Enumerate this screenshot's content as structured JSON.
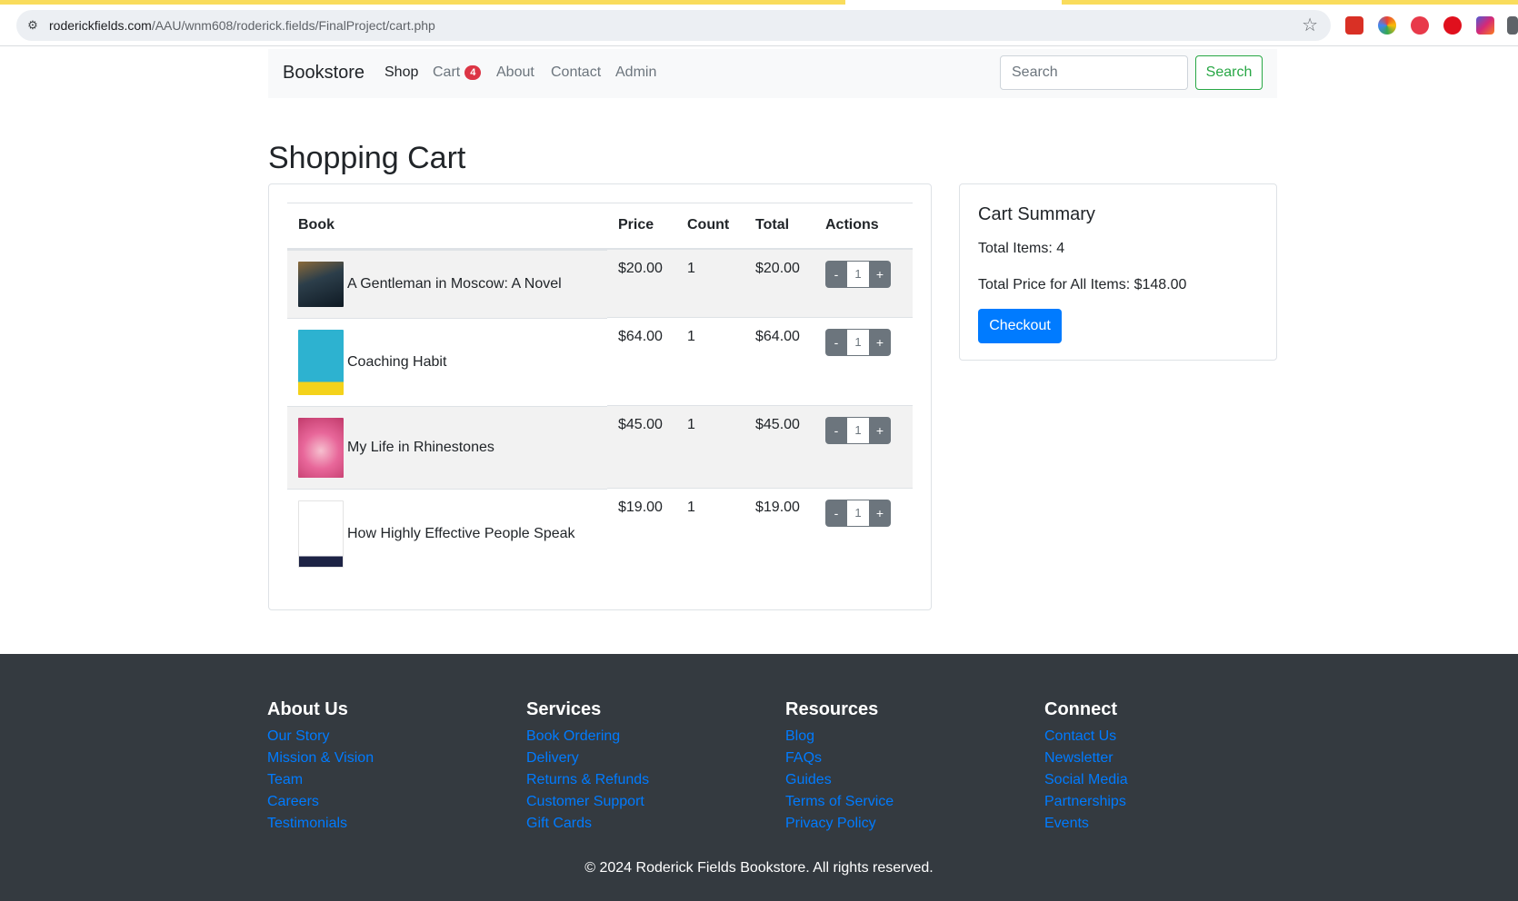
{
  "browser": {
    "url_domain": "roderickfields.com",
    "url_path": "/AAU/wnm608/roderick.fields/FinalProject/cart.php"
  },
  "navbar": {
    "brand": "Bookstore",
    "links": [
      {
        "label": "Shop"
      },
      {
        "label": "Cart",
        "badge": "4"
      },
      {
        "label": "About"
      },
      {
        "label": "Contact"
      },
      {
        "label": "Admin"
      }
    ],
    "search_placeholder": "Search",
    "search_button": "Search"
  },
  "page_title": "Shopping Cart",
  "cart": {
    "headers": [
      "Book",
      "Price",
      "Count",
      "Total",
      "Actions"
    ],
    "rows": [
      {
        "title": "A Gentleman in Moscow: A Novel",
        "price": "$20.00",
        "count": "1",
        "total": "$20.00",
        "qty": "1"
      },
      {
        "title": "Coaching Habit",
        "price": "$64.00",
        "count": "1",
        "total": "$64.00",
        "qty": "1"
      },
      {
        "title": "My Life in Rhinestones",
        "price": "$45.00",
        "count": "1",
        "total": "$45.00",
        "qty": "1"
      },
      {
        "title": "How Highly Effective People Speak",
        "price": "$19.00",
        "count": "1",
        "total": "$19.00",
        "qty": "1"
      }
    ],
    "minus_label": "-",
    "plus_label": "+"
  },
  "summary": {
    "title": "Cart Summary",
    "total_items": "Total Items: 4",
    "total_price": "Total Price for All Items: $148.00",
    "checkout_label": "Checkout"
  },
  "footer": {
    "columns": [
      {
        "heading": "About Us",
        "links": [
          "Our Story",
          "Mission & Vision",
          "Team",
          "Careers",
          "Testimonials"
        ]
      },
      {
        "heading": "Services",
        "links": [
          "Book Ordering",
          "Delivery",
          "Returns & Refunds",
          "Customer Support",
          "Gift Cards"
        ]
      },
      {
        "heading": "Resources",
        "links": [
          "Blog",
          "FAQs",
          "Guides",
          "Terms of Service",
          "Privacy Policy"
        ]
      },
      {
        "heading": "Connect",
        "links": [
          "Contact Us",
          "Newsletter",
          "Social Media",
          "Partnerships",
          "Events"
        ]
      }
    ],
    "copyright": "© 2024 Roderick Fields Bookstore. All rights reserved."
  },
  "colors": {
    "primary": "#007bff",
    "success": "#28a745",
    "danger": "#dc3545",
    "secondary": "#6c757d",
    "footer_bg": "#343a40"
  }
}
